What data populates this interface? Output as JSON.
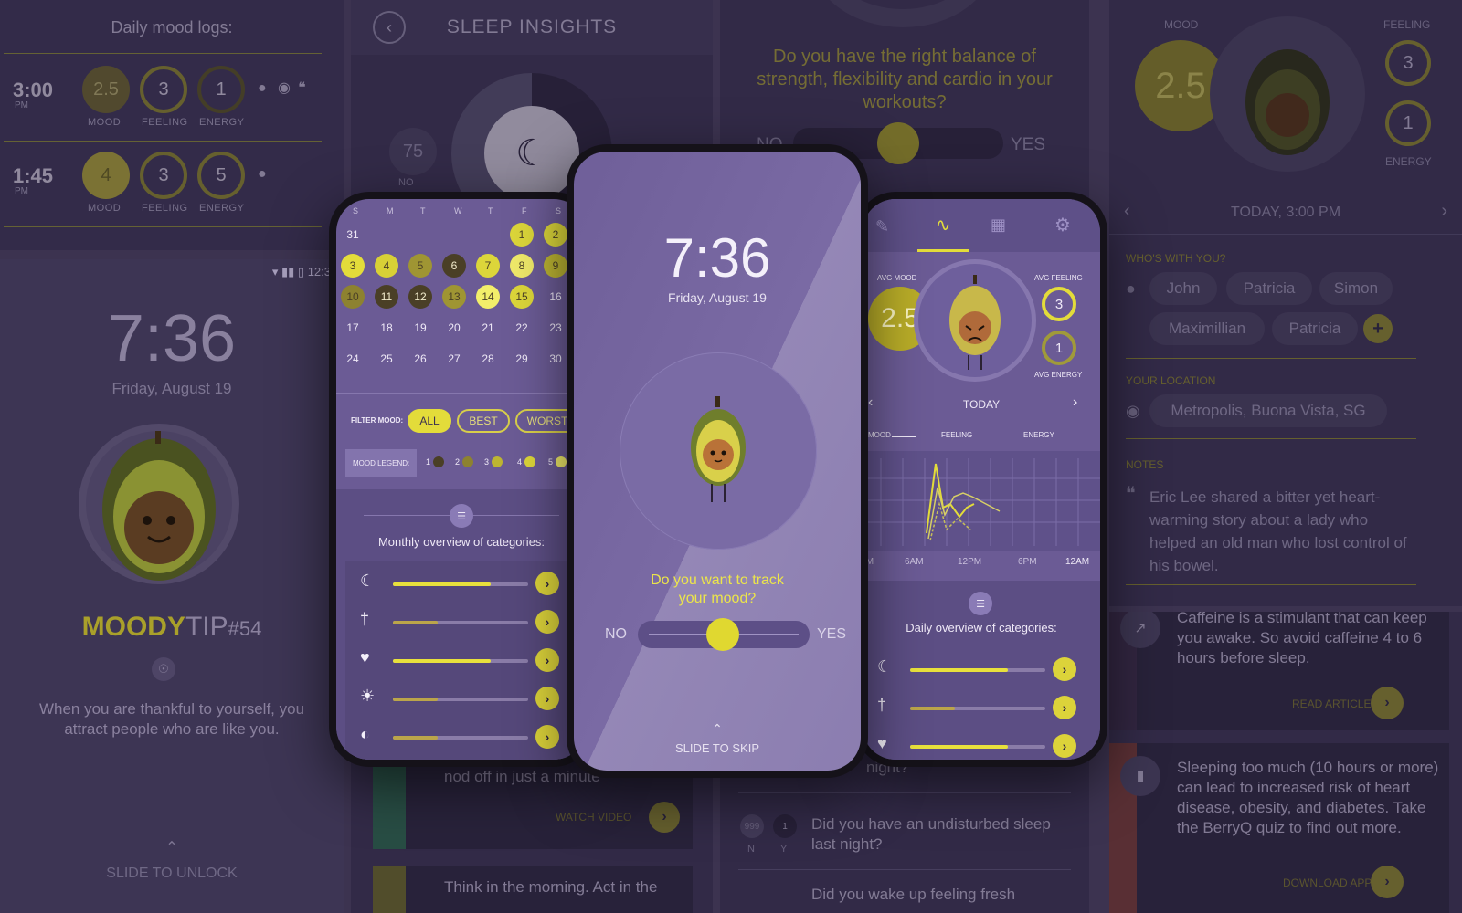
{
  "background": {
    "mood_logs": {
      "title": "Daily mood logs:",
      "entries": [
        {
          "time": "3:00",
          "ampm": "PM",
          "mood": "2.5",
          "feeling": "3",
          "energy": "1"
        },
        {
          "time": "1:45",
          "ampm": "PM",
          "mood": "4",
          "feeling": "3",
          "energy": "5"
        }
      ],
      "labels": {
        "mood": "MOOD",
        "feeling": "FEELING",
        "energy": "ENERGY"
      }
    },
    "lock": {
      "status_time": "12:3",
      "time": "7:36",
      "date": "Friday, August 19",
      "tip_brand": "MOODY",
      "tip_word": "TIP",
      "tip_num": "#54",
      "tip_text": "When you are thankful to yourself, you attract people who are like you.",
      "slide": "SLIDE TO UNLOCK"
    },
    "sleep": {
      "title": "SLEEP INSIGHTS",
      "score": "75",
      "no": "NO",
      "card1_text": "breathing technique to help you nod off in just a minute",
      "card1_action": "WATCH VIDEO",
      "card2_text": "Think in the morning. Act in the"
    },
    "quiz": {
      "question": "Do you have the right balance of strength, flexibility and cardio in your workouts?",
      "no": "NO",
      "yes": "YES",
      "q2_prev": "sleep more than 7 hours at night?",
      "q3": "Did you have an undisturbed sleep last night?",
      "q3_n": "999",
      "q3_y": "1",
      "n": "N",
      "y": "Y",
      "q4": "Did you wake up feeling fresh"
    },
    "detail": {
      "mood_label": "MOOD",
      "feeling_label": "FEELING",
      "energy_label": "ENERGY",
      "mood": "2.5",
      "feeling": "3",
      "energy": "1",
      "date": "TODAY, 3:00 PM",
      "who_label": "WHO'S WITH YOU?",
      "people": [
        "John",
        "Patricia",
        "Simon",
        "Maximillian",
        "Patricia"
      ],
      "location_label": "YOUR LOCATION",
      "location": "Metropolis, Buona Vista, SG",
      "notes_label": "NOTES",
      "notes": "Eric Lee shared a bitter yet heart-warming story about a lady who helped an old man who lost control of his bowel."
    },
    "articles": {
      "a1_text": "Caffeine is a stimulant that can keep you awake. So avoid caffeine 4 to 6 hours before sleep.",
      "a1_action": "READ ARTICLE",
      "a2_text": "Sleeping too much (10 hours or more) can lead to increased risk of heart disease, obesity, and diabetes. Take the BerryQ quiz to find out more.",
      "a2_action": "DOWNLOAD APP"
    }
  },
  "calendar": {
    "weekdays": [
      "S",
      "M",
      "T",
      "W",
      "T",
      "F",
      "S"
    ],
    "filter_label": "FILTER MOOD:",
    "filters": [
      "ALL",
      "BEST",
      "WORST"
    ],
    "legend_label": "MOOD LEGEND:",
    "legend": [
      "1",
      "2",
      "3",
      "4",
      "5"
    ],
    "overview_title": "Monthly overview of categories:",
    "categories": [
      {
        "icon": "sleep-icon",
        "value": 0.72
      },
      {
        "icon": "food-icon",
        "value": 0.33
      },
      {
        "icon": "health-icon",
        "value": 0.72
      },
      {
        "icon": "exercise-icon",
        "value": 0.33
      },
      {
        "icon": "mind-icon",
        "value": 0.33
      }
    ]
  },
  "center": {
    "time": "7:36",
    "date": "Friday, August 19",
    "question": "Do you want to track your mood?",
    "no": "NO",
    "yes": "YES",
    "skip": "SLIDE TO SKIP"
  },
  "stats": {
    "avg_mood_label": "AVG MOOD",
    "avg_mood": "2.5",
    "avg_feeling_label": "AVG FEELING",
    "avg_feeling": "3",
    "avg_energy_label": "AVG ENERGY",
    "avg_energy": "1",
    "day": "TODAY",
    "legend": [
      "MOOD",
      "FEELING",
      "ENERGY"
    ],
    "x_ticks": [
      "12AM",
      "6AM",
      "12PM",
      "6PM",
      "12AM"
    ],
    "overview_title": "Daily overview of categories:",
    "categories": [
      {
        "icon": "sleep-icon",
        "value": 0.72
      },
      {
        "icon": "food-icon",
        "value": 0.33
      },
      {
        "icon": "health-icon",
        "value": 0.72
      }
    ]
  },
  "colors": {
    "accent": "#e3dc3a",
    "bg": "#3c3350",
    "panel": "#40375a",
    "screen": "#6f5f99"
  }
}
